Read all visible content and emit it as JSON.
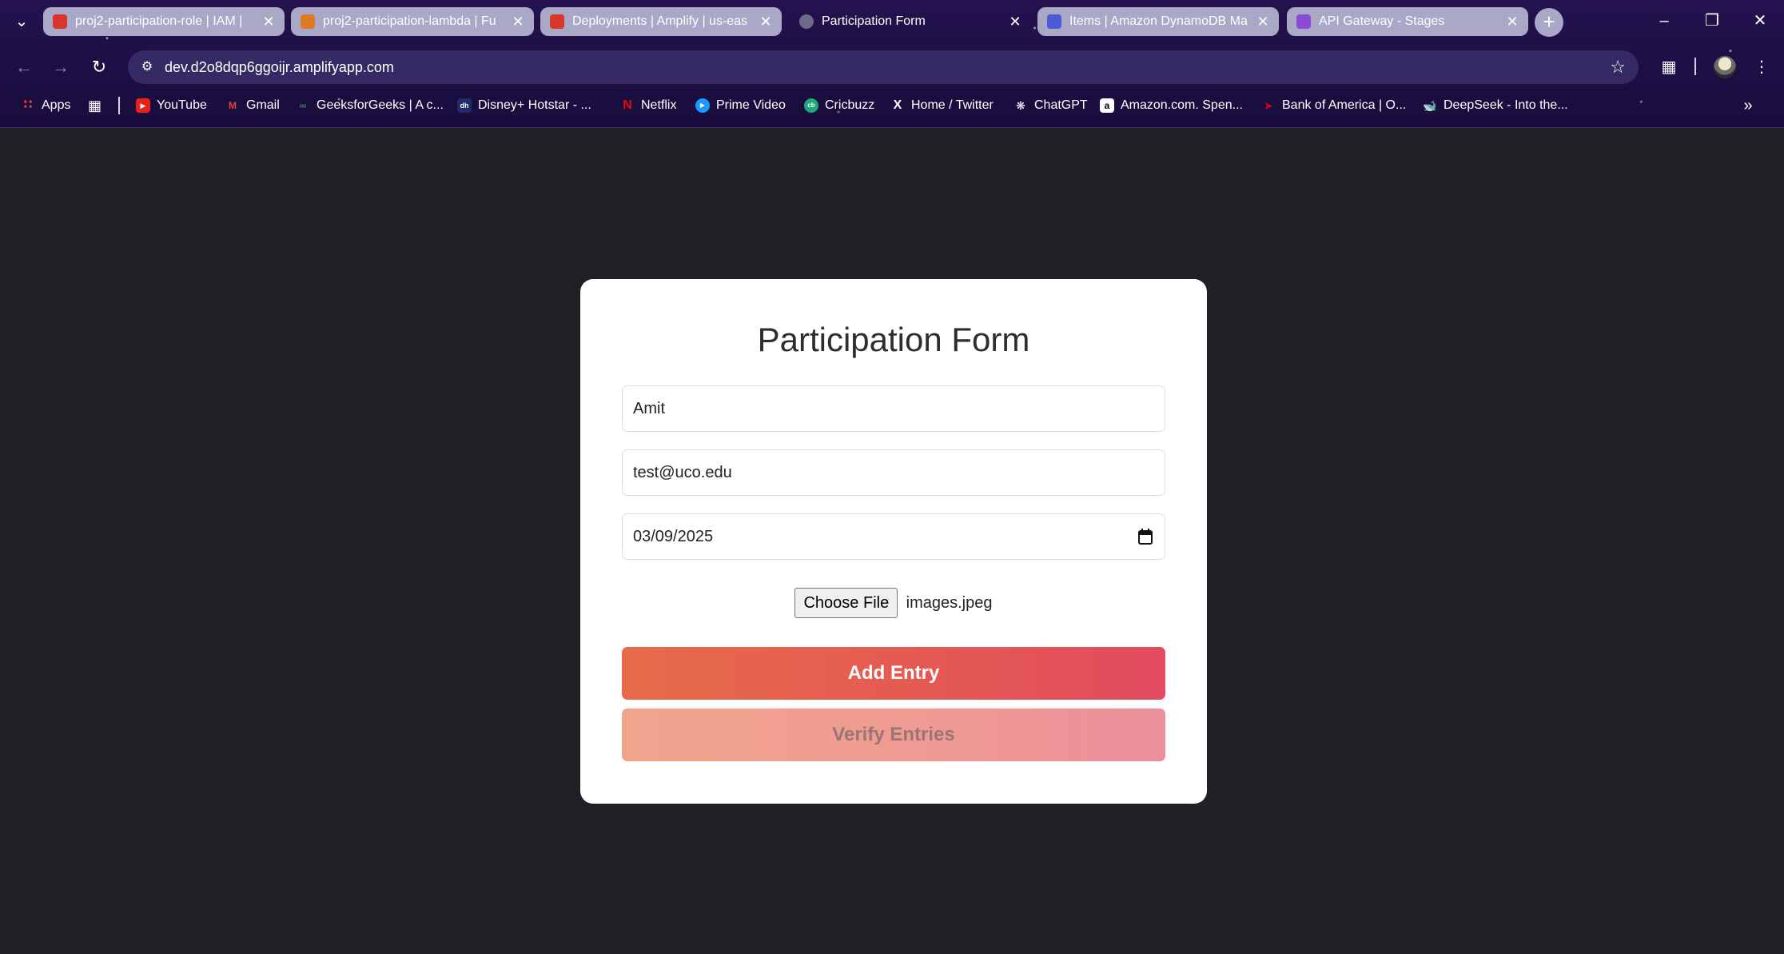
{
  "browser": {
    "tabs": [
      {
        "title": "proj2-participation-role | IAM | ",
        "favicon_color": "#d9352b",
        "active": false
      },
      {
        "title": "proj2-participation-lambda | Fu",
        "favicon_color": "#e07a22",
        "active": false
      },
      {
        "title": "Deployments | Amplify | us-eas",
        "favicon_color": "#d9352b",
        "active": false
      },
      {
        "title": "Participation Form",
        "favicon_color": "#6f6a8a",
        "active": true
      },
      {
        "title": "Items | Amazon DynamoDB Ma",
        "favicon_color": "#4b5bd6",
        "active": false
      },
      {
        "title": "API Gateway - Stages",
        "favicon_color": "#8a4bd6",
        "active": false
      }
    ],
    "url": "dev.d2o8dqp6ggoijr.amplifyapp.com",
    "bookmarks": [
      {
        "label": "Apps",
        "icon": "apps-grid-icon",
        "color": "#e8453c"
      },
      {
        "label": "YouTube",
        "icon": "youtube-icon",
        "color": "#e62117"
      },
      {
        "label": "Gmail",
        "icon": "gmail-icon",
        "color": "#ea4335"
      },
      {
        "label": "GeeksforGeeks | A c...",
        "icon": "geeksforgeeks-icon",
        "color": "#2f8d46"
      },
      {
        "label": "Disney+ Hotstar - ...",
        "icon": "hotstar-icon",
        "color": "#1f2a6b"
      },
      {
        "label": "Netflix",
        "icon": "netflix-icon",
        "color": "#e50914"
      },
      {
        "label": "Prime Video",
        "icon": "prime-video-icon",
        "color": "#1a98ff"
      },
      {
        "label": "Cricbuzz",
        "icon": "cricbuzz-icon",
        "color": "#1ba97a"
      },
      {
        "label": "Home / Twitter",
        "icon": "x-twitter-icon",
        "color": "#000000"
      },
      {
        "label": "ChatGPT",
        "icon": "chatgpt-icon",
        "color": "#1a1a1a"
      },
      {
        "label": "Amazon.com. Spen...",
        "icon": "amazon-icon",
        "color": "#ffffff"
      },
      {
        "label": "Bank of America | O...",
        "icon": "bank-of-america-icon",
        "color": "#d4001a"
      },
      {
        "label": "DeepSeek - Into the...",
        "icon": "deepseek-icon",
        "color": "#4d6bfe"
      }
    ]
  },
  "form": {
    "title": "Participation Form",
    "name_value": "Amit",
    "email_value": "test@uco.edu",
    "date_value": "03/09/2025",
    "file_button_label": "Choose File",
    "file_name": "images.jpeg",
    "add_button_label": "Add Entry",
    "verify_button_label": "Verify Entries"
  },
  "colors": {
    "page_background": "#202124",
    "card_background": "#ffffff",
    "add_button": "#e45a52",
    "verify_button": "#ef9a92"
  }
}
